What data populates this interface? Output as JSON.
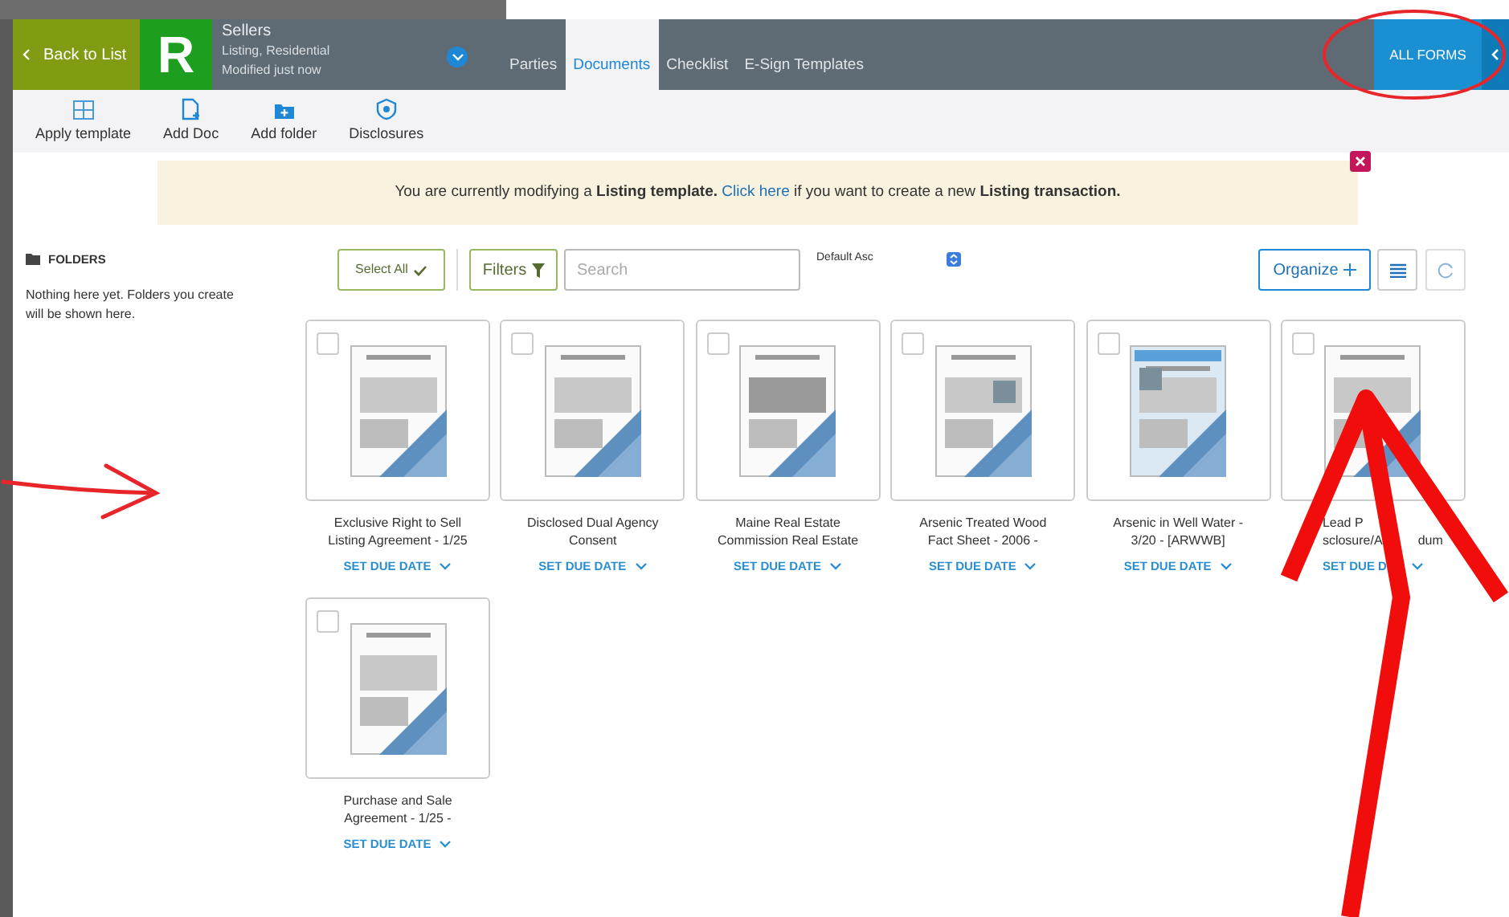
{
  "header": {
    "back_button": "Back to List",
    "logo_letter": "R",
    "title": "Sellers",
    "subtitle": "Listing, Residential",
    "modified": "Modified just now",
    "tabs": [
      {
        "label": "Parties",
        "selected": false
      },
      {
        "label": "Documents",
        "selected": true
      },
      {
        "label": "Checklist",
        "selected": false
      },
      {
        "label": "E-Sign Templates",
        "selected": false
      }
    ],
    "all_forms_button": "ALL FORMS"
  },
  "toolbar": [
    {
      "kind": "template",
      "label": "Apply template"
    },
    {
      "kind": "doc",
      "label": "Add Doc"
    },
    {
      "kind": "folder",
      "label": "Add folder"
    },
    {
      "kind": "shield",
      "label": "Disclosures"
    }
  ],
  "banner": {
    "text_before": "You are currently modifying a **Listing template.**",
    "link": "Click here",
    "text_after": "if you want to create a new **Listing transaction.**"
  },
  "sidebar": {
    "heading": "FOLDERS",
    "empty_text": "Nothing here yet. Folders you create will be shown here."
  },
  "controls": {
    "select_all": "Select All",
    "filters": "Filters",
    "search_placeholder": "Search",
    "sort": "Default Asc",
    "organize": "Organize"
  },
  "documents": [
    {
      "title_lines": [
        [
          "Exclusive Right to Sell"
        ],
        [
          "Listing Agreement - 1/25"
        ]
      ],
      "due": "SET DUE DATE",
      "checked": false
    },
    {
      "title_lines": [
        [
          "Disclosed Dual Agency"
        ],
        [
          "Consent"
        ]
      ],
      "due": "SET DUE DATE",
      "checked": false
    },
    {
      "title_lines": [
        [
          "Maine Real Estate"
        ],
        [
          "Commission Real Estate"
        ]
      ],
      "due": "SET DUE DATE",
      "checked": false
    },
    {
      "title_lines": [
        [
          "Arsenic Treated Wood"
        ],
        [
          "Fact Sheet - 2006 -"
        ]
      ],
      "due": "SET DUE DATE",
      "checked": false
    },
    {
      "title_lines": [
        [
          "Arsenic in Well Water -"
        ],
        [
          "3/20 - [ARWWB]"
        ]
      ],
      "due": "SET DUE DATE",
      "checked": false
    },
    {
      "title_lines": [
        [
          "Lead P"
        ],
        [
          "sclosure/A",
          "dum"
        ]
      ],
      "due": "SET DUE D",
      "checked": false
    },
    {
      "title_lines": [
        [
          "Purchase and Sale"
        ],
        [
          "Agreement - 1/25 -"
        ]
      ],
      "due": "SET DUE DATE",
      "checked": false
    }
  ]
}
